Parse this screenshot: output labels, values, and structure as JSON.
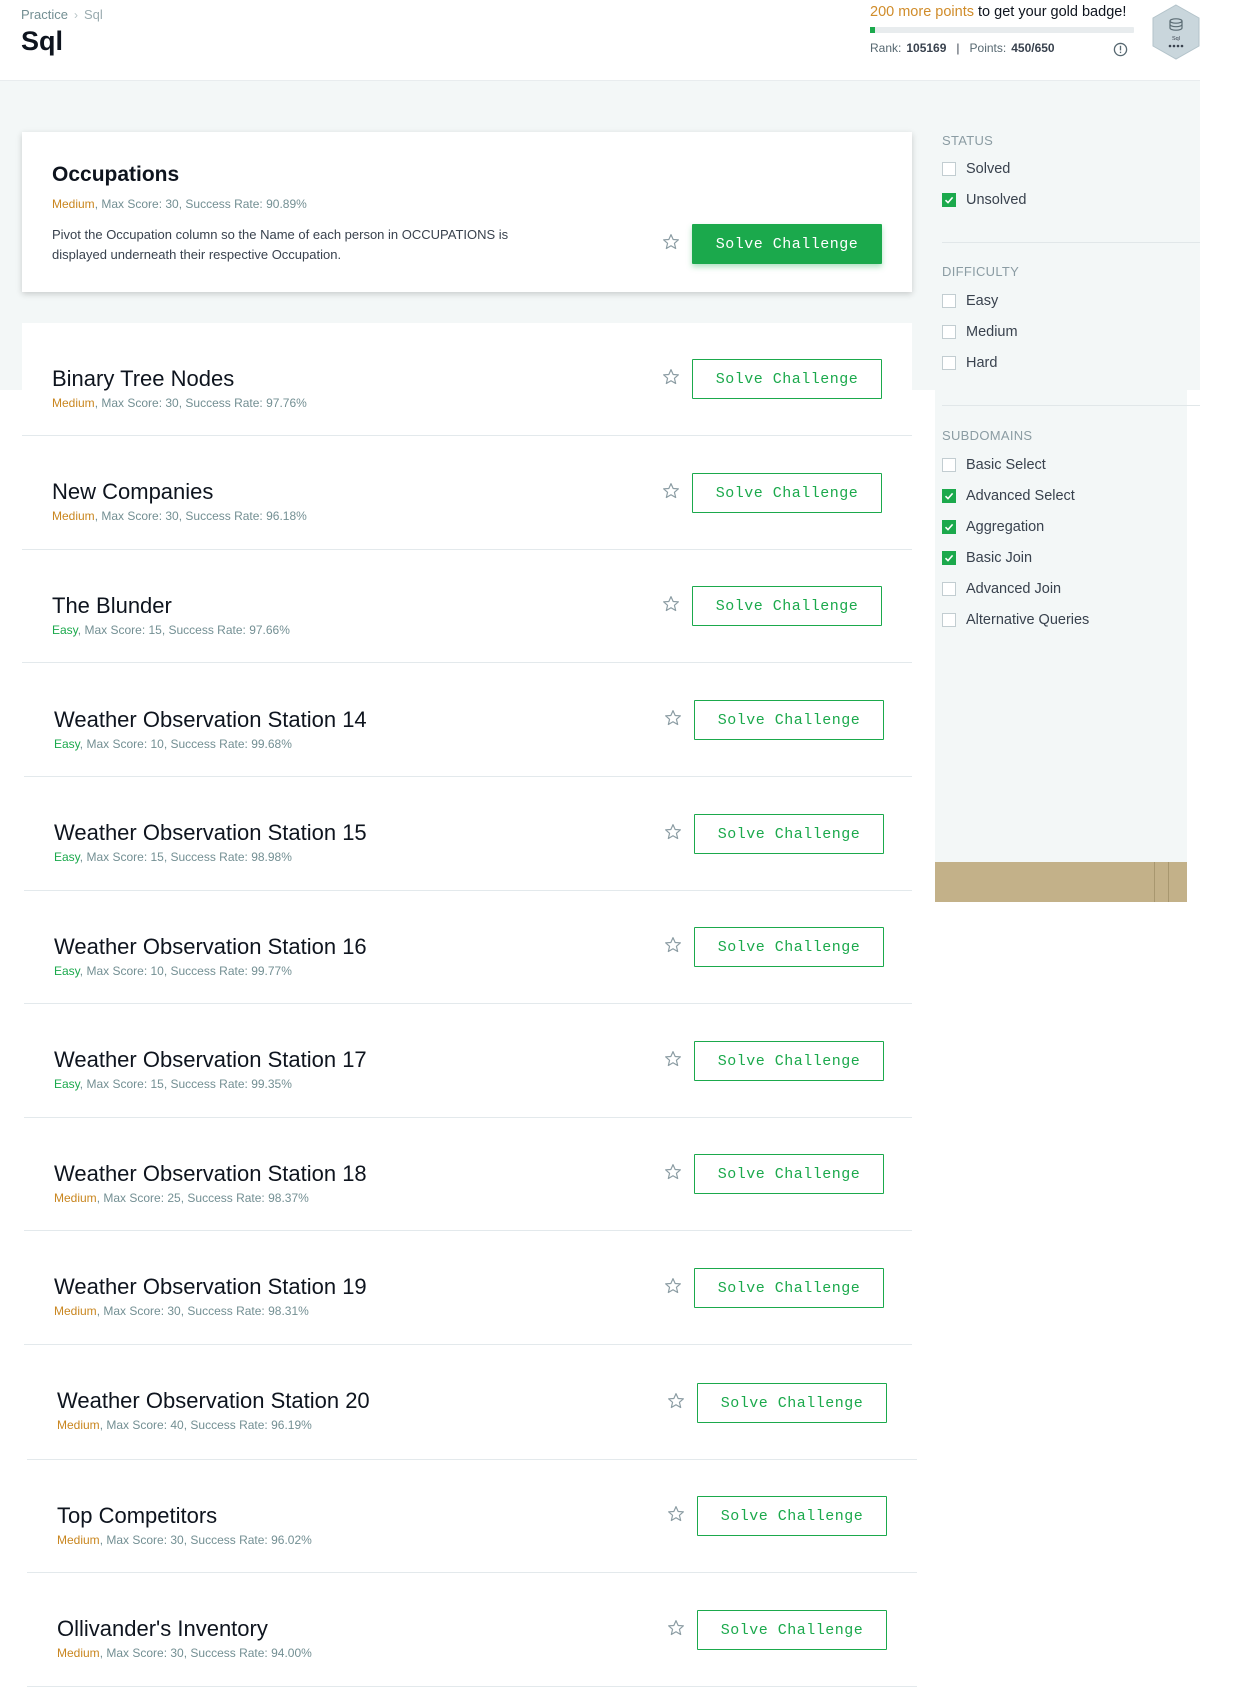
{
  "breadcrumb": {
    "parent": "Practice",
    "current": "Sql"
  },
  "page_title": "Sql",
  "progress": {
    "points_needed": "200 more points",
    "message_rest": " to get your gold badge!",
    "fill_fraction": 0.02,
    "rank_label": "Rank:",
    "rank_value": "105169",
    "points_label": "Points:",
    "points_value": "450/650"
  },
  "badge": {
    "label": "Sql",
    "icon": "database-icon"
  },
  "challenges": [
    {
      "title": "Occupations",
      "difficulty": "Medium",
      "rest": ", Max Score: 30, Success Rate: 90.89%",
      "description": "Pivot the Occupation column so the Name of each person in OCCUPATIONS is displayed underneath their respective Occupation.",
      "button": "Solve Challenge"
    },
    {
      "title": "Binary Tree Nodes",
      "difficulty": "Medium",
      "rest": ", Max Score: 30, Success Rate: 97.76%",
      "button": "Solve Challenge"
    },
    {
      "title": "New Companies",
      "difficulty": "Medium",
      "rest": ", Max Score: 30, Success Rate: 96.18%",
      "button": "Solve Challenge"
    },
    {
      "title": "The Blunder",
      "difficulty": "Easy",
      "rest": ", Max Score: 15, Success Rate: 97.66%",
      "button": "Solve Challenge"
    },
    {
      "title": "Weather Observation Station 14",
      "difficulty": "Easy",
      "rest": ", Max Score: 10, Success Rate: 99.68%",
      "button": "Solve Challenge"
    },
    {
      "title": "Weather Observation Station 15",
      "difficulty": "Easy",
      "rest": ", Max Score: 15, Success Rate: 98.98%",
      "button": "Solve Challenge"
    },
    {
      "title": "Weather Observation Station 16",
      "difficulty": "Easy",
      "rest": ", Max Score: 10, Success Rate: 99.77%",
      "button": "Solve Challenge"
    },
    {
      "title": "Weather Observation Station 17",
      "difficulty": "Easy",
      "rest": ", Max Score: 15, Success Rate: 99.35%",
      "button": "Solve Challenge"
    },
    {
      "title": "Weather Observation Station 18",
      "difficulty": "Medium",
      "rest": ", Max Score: 25, Success Rate: 98.37%",
      "button": "Solve Challenge"
    },
    {
      "title": "Weather Observation Station 19",
      "difficulty": "Medium",
      "rest": ", Max Score: 30, Success Rate: 98.31%",
      "button": "Solve Challenge"
    },
    {
      "title": "Weather Observation Station 20",
      "difficulty": "Medium",
      "rest": ", Max Score: 40, Success Rate: 96.19%",
      "button": "Solve Challenge"
    },
    {
      "title": "Top Competitors",
      "difficulty": "Medium",
      "rest": ", Max Score: 30, Success Rate: 96.02%",
      "button": "Solve Challenge"
    },
    {
      "title": "Ollivander's Inventory",
      "difficulty": "Medium",
      "rest": ", Max Score: 30, Success Rate: 94.00%",
      "button": "Solve Challenge"
    }
  ],
  "filters": {
    "status": {
      "heading": "STATUS",
      "options": [
        {
          "label": "Solved",
          "checked": false
        },
        {
          "label": "Unsolved",
          "checked": true
        }
      ]
    },
    "difficulty": {
      "heading": "DIFFICULTY",
      "options": [
        {
          "label": "Easy",
          "checked": false
        },
        {
          "label": "Medium",
          "checked": false
        },
        {
          "label": "Hard",
          "checked": false
        }
      ]
    },
    "subdomains": {
      "heading": "SUBDOMAINS",
      "options": [
        {
          "label": "Basic Select",
          "checked": false
        },
        {
          "label": "Advanced Select",
          "checked": true
        },
        {
          "label": "Aggregation",
          "checked": true
        },
        {
          "label": "Basic Join",
          "checked": true
        },
        {
          "label": "Advanced Join",
          "checked": false
        },
        {
          "label": "Alternative Queries",
          "checked": false
        }
      ]
    }
  },
  "colors": {
    "accent_green": "#1ba94c",
    "medium_orange": "#c9861f",
    "text_dark": "#0e141e",
    "bg_grey": "#f3f7f7"
  }
}
